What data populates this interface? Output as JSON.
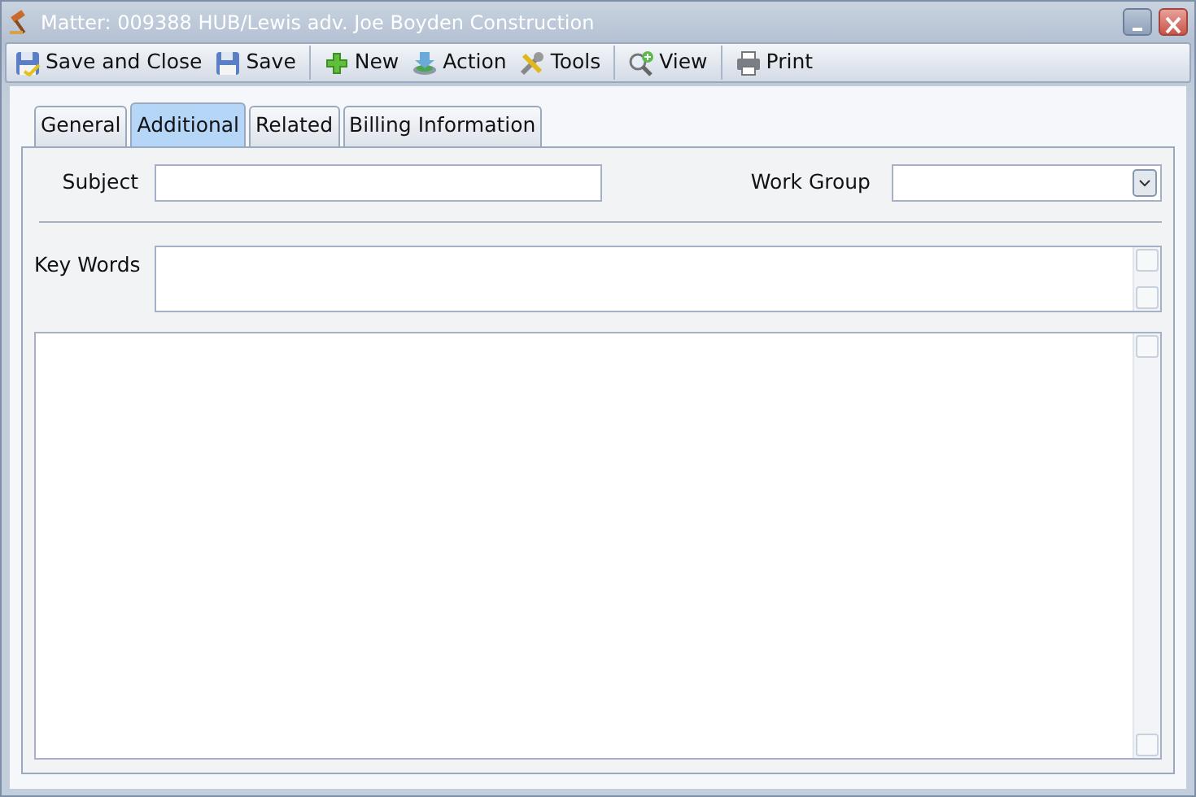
{
  "window": {
    "title": "Matter: 009388 HUB/Lewis adv. Joe Boyden Construction"
  },
  "toolbar": [
    {
      "kind": "save-close",
      "label": "Save and Close"
    },
    {
      "kind": "save",
      "label": "Save"
    },
    {
      "kind": "separator"
    },
    {
      "kind": "new",
      "label": "New"
    },
    {
      "kind": "action",
      "label": "Action"
    },
    {
      "kind": "tools",
      "label": "Tools"
    },
    {
      "kind": "separator"
    },
    {
      "kind": "view",
      "label": "View"
    },
    {
      "kind": "separator"
    },
    {
      "kind": "print",
      "label": "Print"
    }
  ],
  "tabs": [
    {
      "label": "General",
      "selected": false
    },
    {
      "label": "Additional",
      "selected": true
    },
    {
      "label": "Related",
      "selected": false
    },
    {
      "label": "Billing Information",
      "selected": false
    }
  ],
  "form": {
    "subject_label": "Subject",
    "work_group_label": "Work Group",
    "key_words_label": "Key Words"
  }
}
